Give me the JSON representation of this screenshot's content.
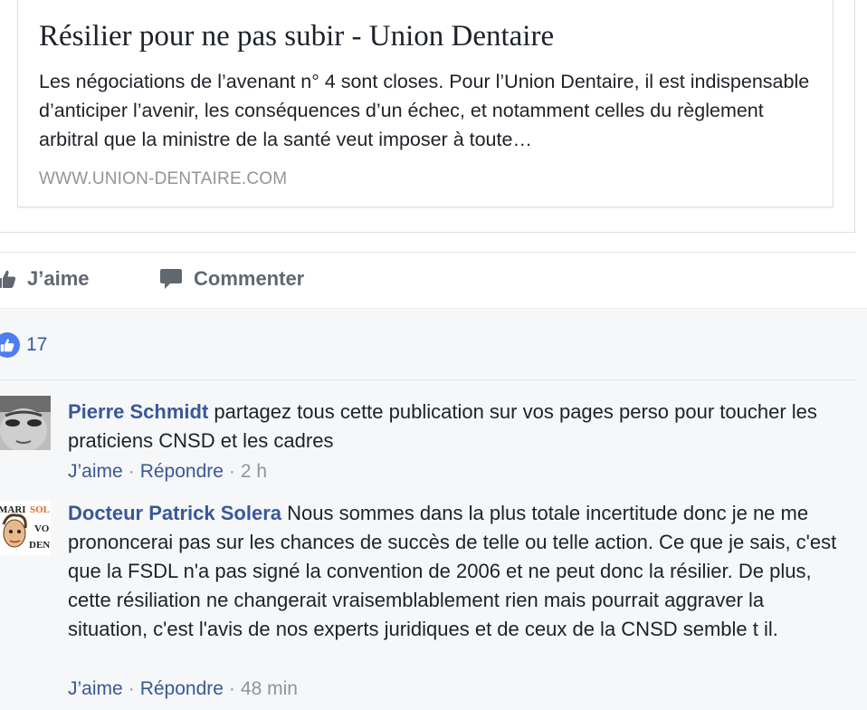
{
  "link_preview": {
    "title": "Résilier pour ne pas subir - Union Dentaire",
    "description": "Les négociations de l’avenant n° 4 sont closes. Pour l’Union Dentaire, il est indispensable d’anticiper l’avenir, les conséquences d’un échec, et notamment celles du règlement arbitral que la ministre de la santé veut imposer à toute…",
    "domain": "WWW.UNION-DENTAIRE.COM"
  },
  "actions": {
    "like_label": "J’aime",
    "comment_label": "Commenter"
  },
  "reactions": {
    "count": "17"
  },
  "comments": [
    {
      "author": "Pierre Schmidt",
      "text": "partagez tous cette publication sur vos pages perso pour toucher les praticiens CNSD et les cadres",
      "like_label": "J’aime",
      "reply_label": "Répondre",
      "time": "2 h",
      "separator": "·"
    },
    {
      "author": "Docteur Patrick Solera",
      "text": "Nous sommes dans la plus totale incertitude donc je ne me prononcerai pas sur les chances de succès de telle ou telle action. Ce que je sais, c'est que la FSDL n'a pas signé la convention de 2006 et ne peut donc la résilier. De plus, cette résiliation ne changerait vraisemblablement rien mais pourrait aggraver la situation, c'est l'avis de nos experts juridiques et de ceux de la CNSD semble t il.",
      "like_label": "J’aime",
      "reply_label": "Répondre",
      "time": "48 min",
      "separator": "·",
      "avatar_text": [
        "MARI",
        "SOL",
        "VO",
        "DEN"
      ]
    }
  ],
  "colors": {
    "link_blue": "#385898",
    "meta_gray": "#90949c",
    "text": "#1d2129",
    "like_badge": "#4e7df1",
    "comments_bg": "#f6f7f9"
  },
  "icons": {
    "like": "thumbs-up-icon",
    "comment": "speech-bubble-icon",
    "reaction": "like-reaction-icon"
  }
}
